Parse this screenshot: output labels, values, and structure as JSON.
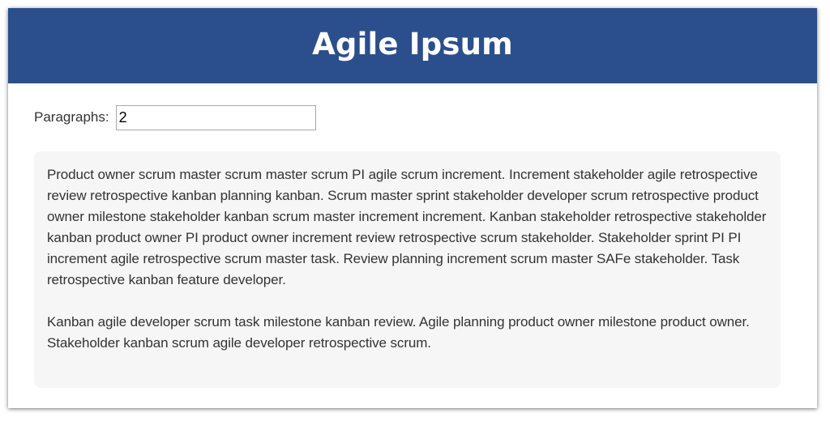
{
  "header": {
    "title": "Agile Ipsum"
  },
  "controls": {
    "paragraphs_label": "Paragraphs:",
    "paragraphs_value": "2"
  },
  "output": {
    "paragraphs": [
      "Product owner scrum master scrum master scrum PI agile scrum increment. Increment stakeholder agile retrospective review retrospective kanban planning kanban. Scrum master sprint stakeholder developer scrum retrospective product owner milestone stakeholder kanban scrum master increment increment. Kanban stakeholder retrospective stakeholder kanban product owner PI product owner increment review retrospective scrum stakeholder. Stakeholder sprint PI PI increment agile retrospective scrum master task. Review planning increment scrum master SAFe stakeholder. Task retrospective kanban feature developer.",
      "Kanban agile developer scrum task milestone kanban review. Agile planning product owner milestone product owner. Stakeholder kanban scrum agile developer retrospective scrum."
    ]
  },
  "colors": {
    "header_bg": "#2b4f8c",
    "header_text": "#ffffff",
    "output_bg": "#f6f6f6",
    "body_text": "#333333"
  }
}
